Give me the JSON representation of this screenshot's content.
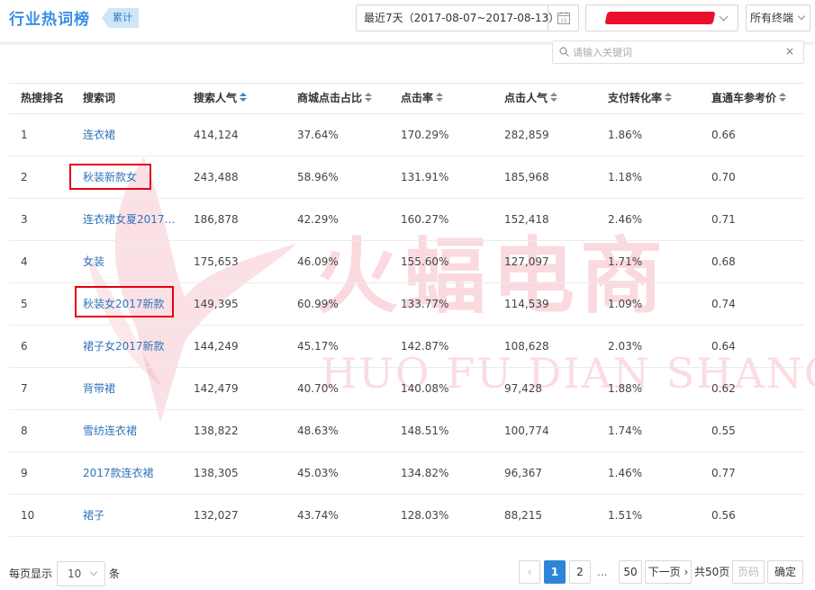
{
  "header": {
    "title": "行业热词榜",
    "tag": "累计",
    "date_range": "最近7天（2017-08-07~2017-08-13）",
    "calendar_day": "15",
    "terminal": "所有终端"
  },
  "search": {
    "placeholder": "请输入关键词",
    "clear": "×"
  },
  "table": {
    "headers": {
      "rank": "热搜排名",
      "keyword": "搜索词",
      "popularity": "搜索人气",
      "mall_click_share": "商城点击占比",
      "ctr": "点击率",
      "click_popularity": "点击人气",
      "conversion": "支付转化率",
      "ref_price": "直通车参考价"
    },
    "rows": [
      {
        "rank": "1",
        "keyword": "连衣裙",
        "popularity": "414,124",
        "mall": "37.64%",
        "ctr": "170.29%",
        "clicks": "282,859",
        "cvr": "1.86%",
        "price": "0.66"
      },
      {
        "rank": "2",
        "keyword": "秋装新款女",
        "popularity": "243,488",
        "mall": "58.96%",
        "ctr": "131.91%",
        "clicks": "185,968",
        "cvr": "1.18%",
        "price": "0.70"
      },
      {
        "rank": "3",
        "keyword": "连衣裙女夏2017新...",
        "popularity": "186,878",
        "mall": "42.29%",
        "ctr": "160.27%",
        "clicks": "152,418",
        "cvr": "2.46%",
        "price": "0.71"
      },
      {
        "rank": "4",
        "keyword": "女装",
        "popularity": "175,653",
        "mall": "46.09%",
        "ctr": "155.60%",
        "clicks": "127,097",
        "cvr": "1.71%",
        "price": "0.68"
      },
      {
        "rank": "5",
        "keyword": "秋装女2017新款",
        "popularity": "149,395",
        "mall": "60.99%",
        "ctr": "133.77%",
        "clicks": "114,539",
        "cvr": "1.09%",
        "price": "0.74"
      },
      {
        "rank": "6",
        "keyword": "裙子女2017新款",
        "popularity": "144,249",
        "mall": "45.17%",
        "ctr": "142.87%",
        "clicks": "108,628",
        "cvr": "2.03%",
        "price": "0.64"
      },
      {
        "rank": "7",
        "keyword": "背带裙",
        "popularity": "142,479",
        "mall": "40.70%",
        "ctr": "140.08%",
        "clicks": "97,428",
        "cvr": "1.88%",
        "price": "0.62"
      },
      {
        "rank": "8",
        "keyword": "雪纺连衣裙",
        "popularity": "138,822",
        "mall": "48.63%",
        "ctr": "148.51%",
        "clicks": "100,774",
        "cvr": "1.74%",
        "price": "0.55"
      },
      {
        "rank": "9",
        "keyword": "2017款连衣裙",
        "popularity": "138,305",
        "mall": "45.03%",
        "ctr": "134.82%",
        "clicks": "96,367",
        "cvr": "1.46%",
        "price": "0.77"
      },
      {
        "rank": "10",
        "keyword": "裙子",
        "popularity": "132,027",
        "mall": "43.74%",
        "ctr": "128.03%",
        "clicks": "88,215",
        "cvr": "1.51%",
        "price": "0.56"
      }
    ]
  },
  "watermark": {
    "main": "火蝠电商",
    "sub": "HUO FU DIAN SHANG"
  },
  "pagination": {
    "per_page_label": "每页显示",
    "per_page_value": "10",
    "per_page_unit": "条",
    "prev": "‹",
    "pages": [
      "1",
      "2",
      "50"
    ],
    "ellipsis": "...",
    "next": "下一页",
    "total": "共50页",
    "goto_placeholder": "页码",
    "confirm": "确定"
  },
  "colors": {
    "accent": "#2f86d8",
    "title": "#3a8ee6",
    "link": "#2f73b8",
    "highlight_box": "#e60012",
    "redaction": "#e8102a"
  }
}
